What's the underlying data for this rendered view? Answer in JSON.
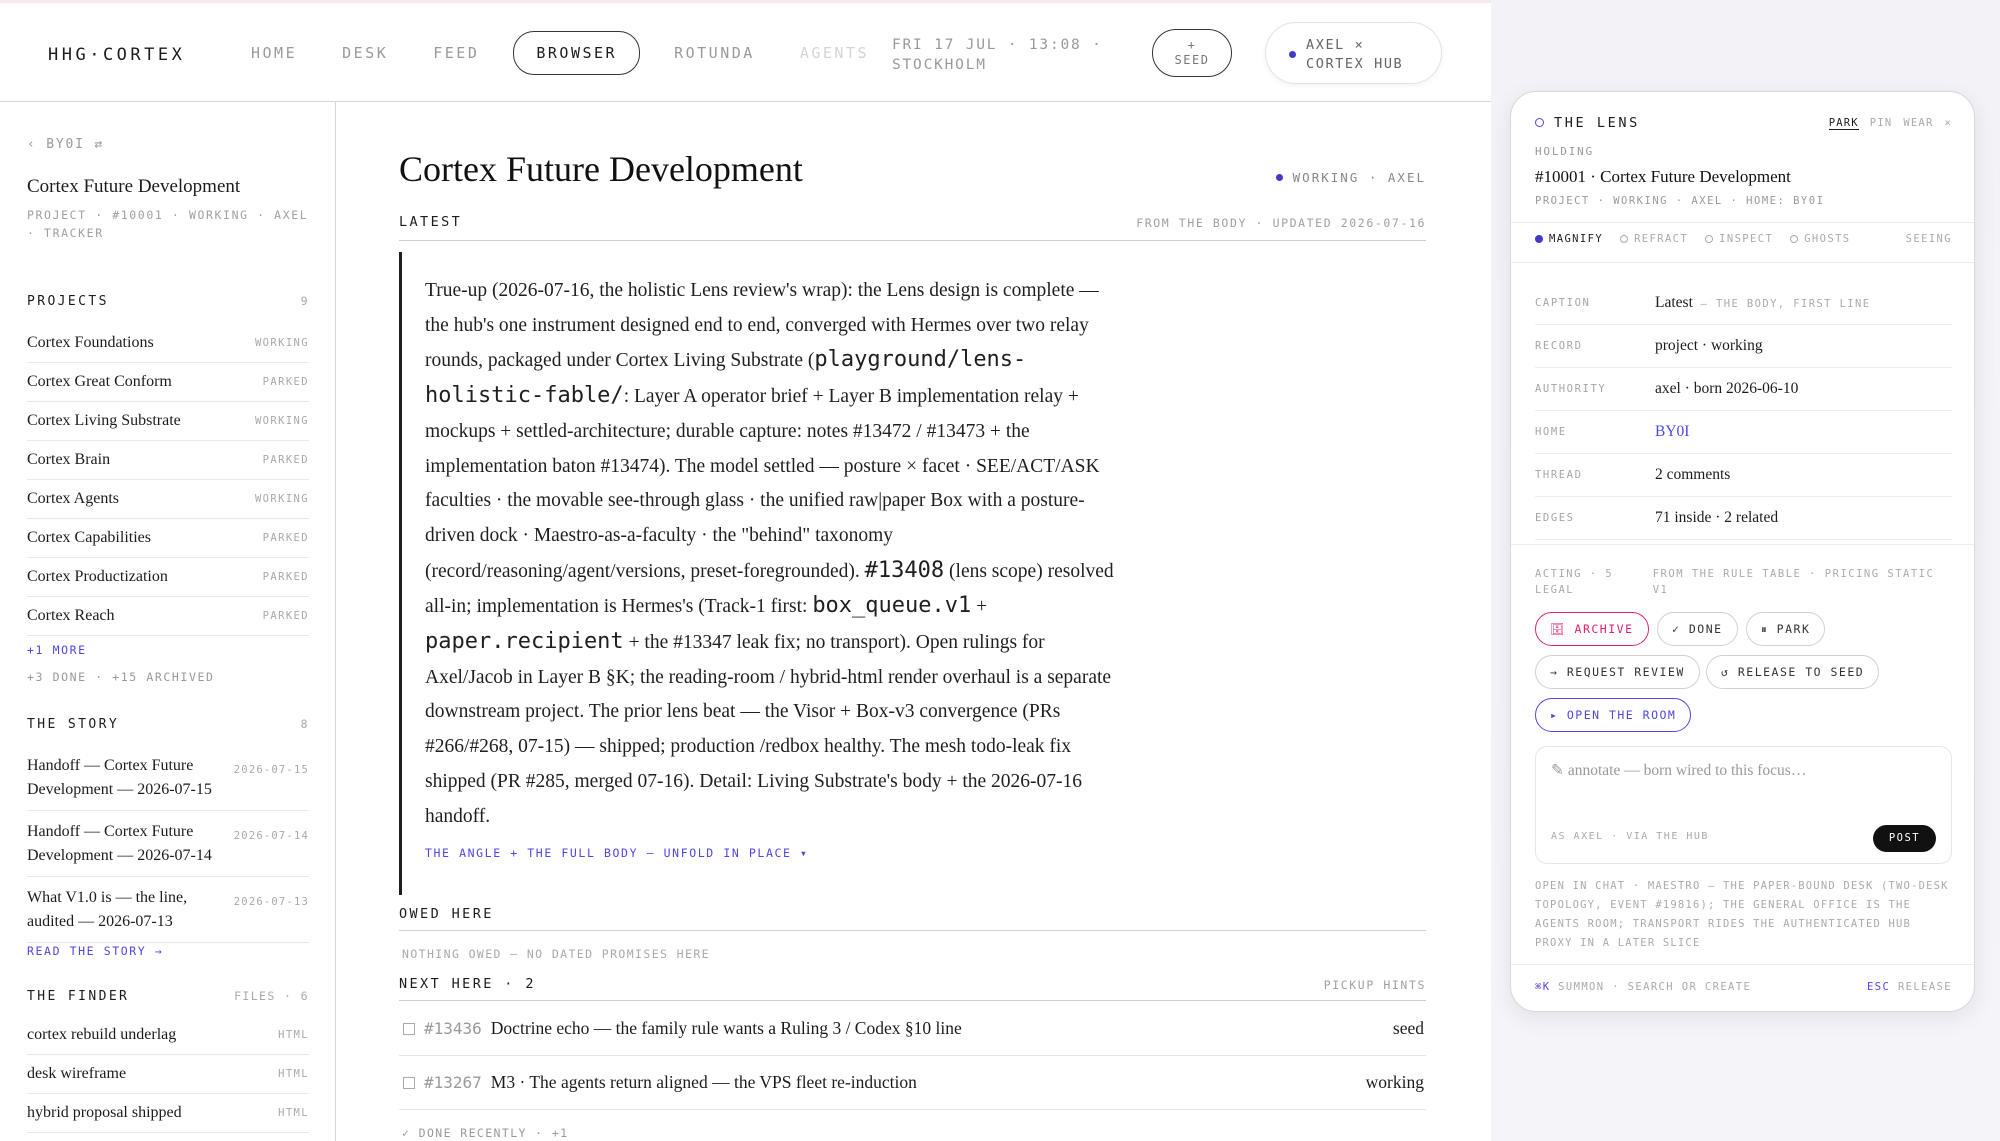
{
  "header": {
    "brand": "HHG·CORTEX",
    "nav": [
      "HOME",
      "DESK",
      "FEED",
      "BROWSER",
      "ROTUNDA",
      "AGENTS"
    ],
    "clock_line1": "FRI 17 JUL · 13:08 ·",
    "clock_line2": "STOCKHOLM",
    "seed_line1": "+",
    "seed_line2": "SEED",
    "user_line1": "AXEL ×",
    "user_line2": "CORTEX HUB"
  },
  "sidebar": {
    "back": "‹ BY0I ⇄",
    "title": "Cortex Future Development",
    "meta": "PROJECT · #10001 · WORKING · AXEL · TRACKER",
    "projects_label": "PROJECTS",
    "projects_count": "9",
    "projects": [
      {
        "name": "Cortex Foundations",
        "status": "WORKING"
      },
      {
        "name": "Cortex Great Conform",
        "status": "PARKED"
      },
      {
        "name": "Cortex Living Substrate",
        "status": "WORKING"
      },
      {
        "name": "Cortex Brain",
        "status": "PARKED"
      },
      {
        "name": "Cortex Agents",
        "status": "WORKING"
      },
      {
        "name": "Cortex Capabilities",
        "status": "PARKED"
      },
      {
        "name": "Cortex Productization",
        "status": "PARKED"
      },
      {
        "name": "Cortex Reach",
        "status": "PARKED"
      }
    ],
    "more": "+1 MORE",
    "done_archived": "+3 DONE · +15 ARCHIVED",
    "story_label": "THE STORY",
    "story_count": "8",
    "story": [
      {
        "title": "Handoff — Cortex Future Development — 2026-07-15",
        "date": "2026-07-15"
      },
      {
        "title": "Handoff — Cortex Future Development — 2026-07-14",
        "date": "2026-07-14"
      },
      {
        "title": "What V1.0 is — the line, audited — 2026-07-13",
        "date": "2026-07-13"
      }
    ],
    "read_story": "READ THE STORY →",
    "finder_label": "THE FINDER",
    "finder_count": "FILES · 6",
    "finder": [
      {
        "name": "cortex rebuild underlag",
        "type": "HTML"
      },
      {
        "name": "desk wireframe",
        "type": "HTML"
      },
      {
        "name": "hybrid proposal shipped",
        "type": "HTML"
      }
    ]
  },
  "main": {
    "title": "Cortex Future Development",
    "status": "WORKING · AXEL",
    "latest_label": "LATEST",
    "latest_meta": "FROM THE BODY · UPDATED 2026-07-16",
    "body": {
      "p1": "True-up (2026-07-16, the holistic Lens review's wrap): the Lens design is complete — the hub's one instrument designed end to end, converged with Hermes over two relay rounds, packaged under Cortex Living Substrate (",
      "code1": "playground/lens-holistic-fable/",
      "p2": ": Layer A operator brief + Layer B implementation relay + mockups + settled-architecture; durable capture: notes #13472 / #13473 + the implementation baton #13474). The model settled — posture × facet · SEE/ACT/ASK faculties · the movable see-through glass · the unified raw|paper Box with a posture-driven dock · Maestro-as-a-faculty · the \"behind\" taxonomy (record/reasoning/agent/versions, preset-foregrounded). ",
      "code2": "#13408",
      "p3": " (lens scope) resolved all-in; implementation is Hermes's (Track-1 first: ",
      "code3": "box_queue.v1",
      "p4": " + ",
      "code4": "paper.recipient",
      "p5": " + the #13347 leak fix; no transport). Open rulings for Axel/Jacob in Layer B §K; the reading-room / hybrid-html render overhaul is a separate downstream project. The prior lens beat — the Visor + Box-v3 convergence (PRs #266/#268, 07-15) — shipped; production /redbox healthy. The mesh todo-leak fix shipped (PR #285, merged 07-16). Detail: Living Substrate's body + the 2026-07-16 handoff."
    },
    "unfold": "THE ANGLE + THE FULL BODY — UNFOLD IN PLACE ▾",
    "owed_label": "OWED HERE",
    "nothing_owed": "NOTHING OWED — NO DATED PROMISES HERE",
    "next_label": "NEXT HERE · 2",
    "next_meta": "PICKUP HINTS",
    "tasks": [
      {
        "num": "#13436",
        "text": "Doctrine echo — the family rule wants a Ruling 3 / Codex §10 line",
        "state": "seed"
      },
      {
        "num": "#13267",
        "text": "M3 · The agents return aligned — the VPS fleet re-induction",
        "state": "working"
      }
    ],
    "done_recent": "✓ DONE RECENTLY · +1"
  },
  "lens": {
    "title": "THE LENS",
    "tabs": [
      "PARK",
      "PIN",
      "WEAR",
      "×"
    ],
    "holding": "HOLDING",
    "name": "#10001 · Cortex Future Development",
    "sub": "PROJECT · WORKING · AXEL · HOME: BY0I",
    "modes": [
      "MAGNIFY",
      "REFRACT",
      "INSPECT",
      "GHOSTS"
    ],
    "seeing": "SEEING",
    "fields": [
      {
        "k": "CAPTION",
        "v": "Latest",
        "note": " — THE BODY, FIRST LINE"
      },
      {
        "k": "RECORD",
        "v": "project · working",
        "note": ""
      },
      {
        "k": "AUTHORITY",
        "v": "axel · born 2026-06-10",
        "note": ""
      },
      {
        "k": "HOME",
        "v": "BY0I",
        "note": ""
      },
      {
        "k": "THREAD",
        "v": "2 comments",
        "note": ""
      },
      {
        "k": "EDGES",
        "v": "71 inside · 2 related",
        "note": ""
      }
    ],
    "acting": "ACTING · 5 LEGAL",
    "acting_src": "FROM THE RULE TABLE · PRICING STATIC V1",
    "actions": {
      "archive": "🗄 ARCHIVE",
      "done": "✓ DONE",
      "park": "⏸ PARK",
      "review": "→ REQUEST REVIEW",
      "release": "↺ RELEASE TO SEED",
      "room": "▸ OPEN THE ROOM"
    },
    "annot_placeholder": "✎ annotate — born wired to this focus…",
    "annot_via": "AS AXEL · VIA THE HUB",
    "post": "POST",
    "footnote": "OPEN IN CHAT · MAESTRO — THE PAPER-BOUND DESK (TWO-DESK TOPOLOGY, EVENT #19816); THE GENERAL OFFICE IS THE AGENTS ROOM; TRANSPORT RIDES THE AUTHENTICATED HUB PROXY IN A LATER SLICE",
    "foot_kb": "⌘K",
    "foot_left": " SUMMON · SEARCH OR CREATE",
    "foot_esc": "ESC",
    "foot_right": " RELEASE"
  },
  "colors": {
    "accent": "#4f46e5",
    "archive": "#e11d74",
    "ink": "#1c1c1c"
  }
}
